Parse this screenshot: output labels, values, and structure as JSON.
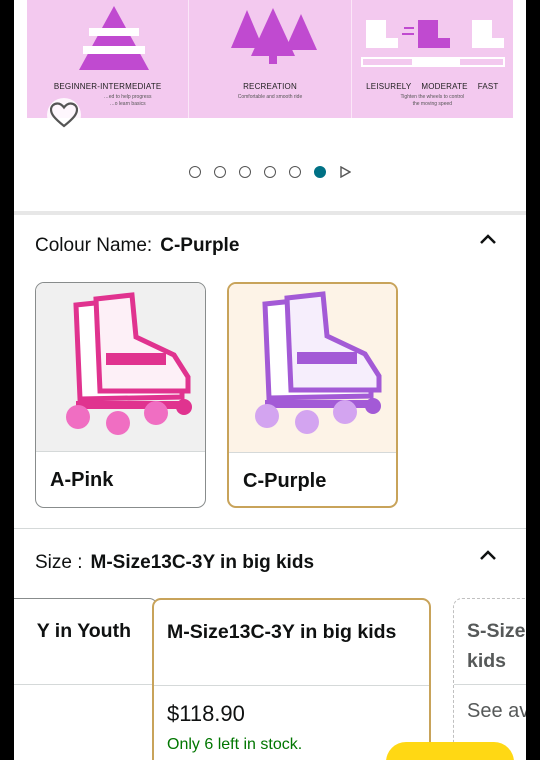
{
  "banner": {
    "panels": [
      {
        "label": "BEGINNER-INTERMEDIATE",
        "sub": "…ed to help progress\n…o learn basics"
      },
      {
        "label": "RECREATION",
        "sub": "Comfortable and smooth ride"
      },
      {
        "speed_labels": [
          "LEISURELY",
          "MODERATE",
          "FAST"
        ],
        "sub": "Tighten the wheels to control\nthe moving speed"
      }
    ]
  },
  "carousel": {
    "dot_count": 6,
    "active_index": 5
  },
  "colour": {
    "label": "Colour Name:",
    "selected": "C-Purple",
    "options": [
      {
        "label": "A-Pink",
        "accent": "#e0338f"
      },
      {
        "label": "C-Purple",
        "accent": "#a35ad6"
      }
    ]
  },
  "size": {
    "label": "Size :",
    "selected": "M-Size13C-3Y in big kids",
    "options": [
      {
        "name": "Y in Youth",
        "price": "",
        "stock": ""
      },
      {
        "name": "M-Size13C-3Y in big kids",
        "price": "$118.90",
        "stock": "Only 6 left in stock."
      },
      {
        "name": "S-Size kids",
        "see": "See av"
      }
    ]
  },
  "colors": {
    "accent": "#007185",
    "selected_border": "#c8a35a",
    "stock": "#007600",
    "banner_bg": "#f3c9ef",
    "buy_button": "#ffd814"
  }
}
